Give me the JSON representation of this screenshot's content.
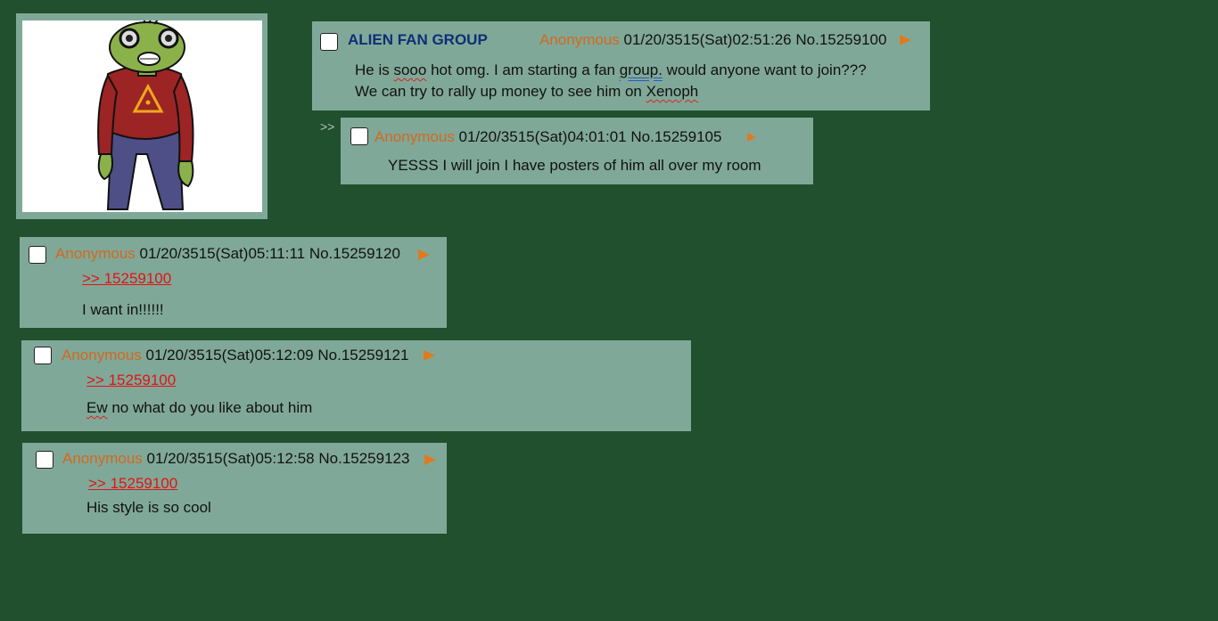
{
  "op": {
    "subject": "ALIEN FAN GROUP",
    "name": "Anonymous",
    "datetime": "01/20/3515(Sat)02:51:26",
    "post_no": "No.15259100",
    "msg_prefix": "He is ",
    "msg_sooo": "sooo",
    "msg_mid": " hot omg. I am starting a fan ",
    "msg_group": "group.",
    "msg_suffix": " would anyone want to join???",
    "msg2_prefix": "We can try to rally up money to see him on ",
    "msg2_xenoph": "Xenoph"
  },
  "reply1": {
    "quote_marker": ">>",
    "name": "Anonymous",
    "datetime": "01/20/3515(Sat)04:01:01",
    "post_no": "No.15259105",
    "message": "YESSS I will join I have posters of him all over my room"
  },
  "reply2": {
    "name": "Anonymous",
    "datetime": "01/20/3515(Sat)05:11:11",
    "post_no": "No.15259120",
    "quote_link": ">> 15259100",
    "message": "I want in!!!!!!"
  },
  "reply3": {
    "name": "Anonymous",
    "datetime": "01/20/3515(Sat)05:12:09",
    "post_no": "No.15259121",
    "quote_link": ">> 15259100",
    "msg_ew": "Ew",
    "msg_rest": " no what do you like about him"
  },
  "reply4": {
    "name": "Anonymous",
    "datetime": "01/20/3515(Sat)05:12:58",
    "post_no": "No.15259123",
    "quote_link": ">> 15259100",
    "message": "His style is so cool"
  }
}
